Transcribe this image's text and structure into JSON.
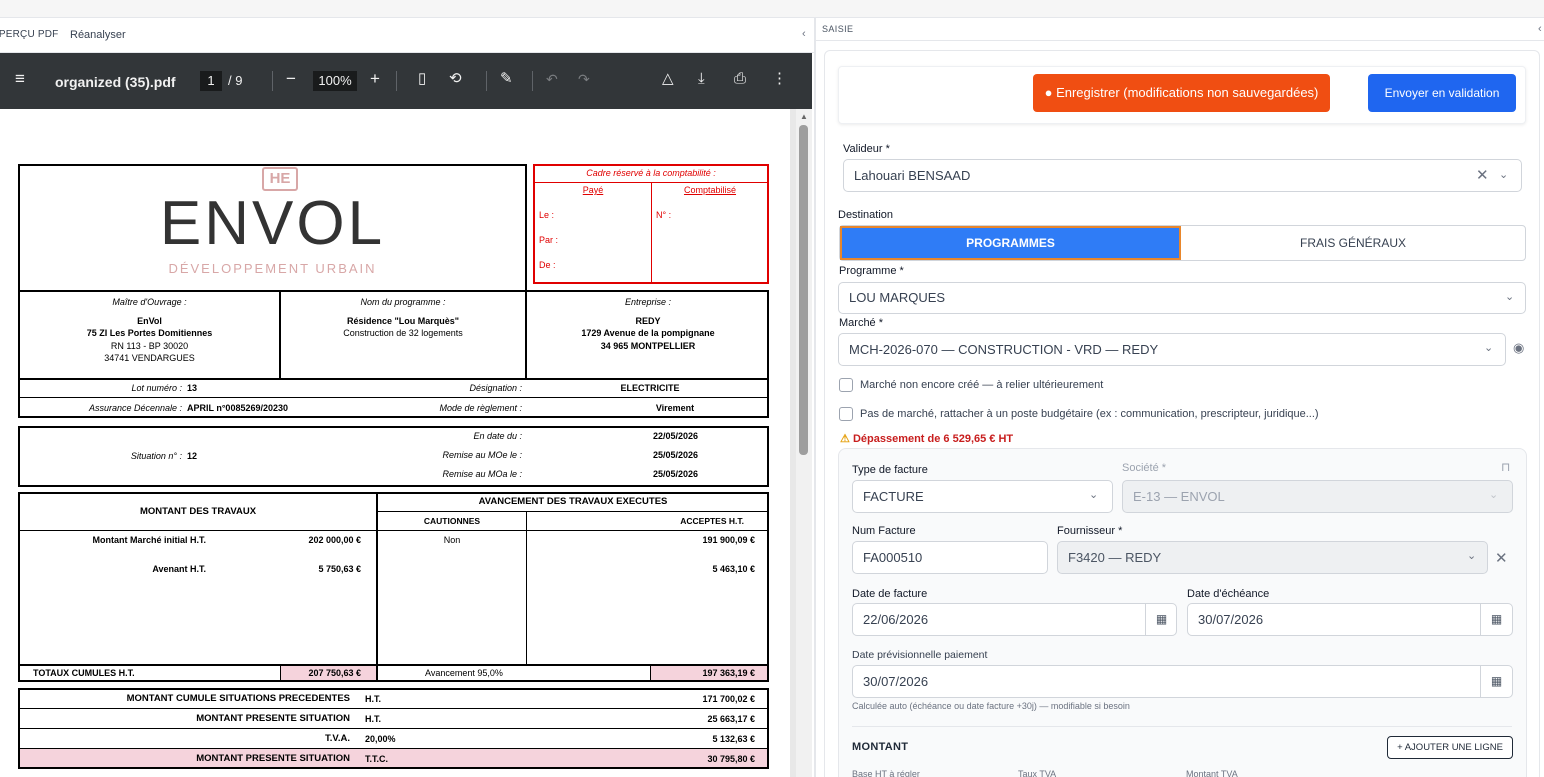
{
  "left": {
    "tab_preview": "APERÇU PDF",
    "tab_reanalyse": "Réanalyser",
    "collapse": "‹"
  },
  "pdf": {
    "filename": "organized (35).pdf",
    "page": "1",
    "of": "/  9",
    "zoom": "100%"
  },
  "doc": {
    "compta_title": "Cadre réservé à la comptabilité :",
    "paye": "Payé",
    "comptabilise": "Comptabilisé",
    "le": "Le :",
    "par": "Par :",
    "de": "De :",
    "no": "N° :",
    "logo_mark": "HE",
    "logo_word": "ENVOL",
    "logo_sub": "DÉVELOPPEMENT URBAIN",
    "moa_label": "Maître d'Ouvrage :",
    "moa_name": "EnVol",
    "moa_addr1": "75 ZI Les Portes Domitiennes",
    "moa_addr2": "RN 113 - BP 30020",
    "moa_addr3": "34741 VENDARGUES",
    "prog_label": "Nom du programme :",
    "prog_name": "Résidence \"Lou Marquès\"",
    "prog_desc": "Construction de 32 logements",
    "ent_label": "Entreprise :",
    "ent_name": "REDY",
    "ent_addr1": "1729 Avenue de la pompignane",
    "ent_addr2": "34 965 MONTPELLIER",
    "lot_label": "Lot numéro :",
    "lot_value": "13",
    "desig_label": "Désignation :",
    "desig_value": "ELECTRICITE",
    "assur_label": "Assurance Décennale :",
    "assur_value": "APRIL n°0085269/20230",
    "mode_label": "Mode de règlement :",
    "mode_value": "Virement",
    "sit_label": "Situation n° :",
    "sit_value": "12",
    "endate_label": "En date du :",
    "endate_value": "22/05/2026",
    "moe_label": "Remise au MOe le :",
    "moe_value": "25/05/2026",
    "moa2_label": "Remise au MOa le :",
    "moa2_value": "25/05/2026",
    "mt_header": "MONTANT DES TRAVAUX",
    "av_header": "AVANCEMENT DES TRAVAUX EXECUTES",
    "cautionnes": "CAUTIONNES",
    "acceptes": "ACCEPTES H.T.",
    "marche_init_label": "Montant Marché initial  H.T.",
    "marche_init_value": "202 000,00 €",
    "marche_caut": "Non",
    "marche_acc": "191 900,09 €",
    "avenant_label": "Avenant  H.T.",
    "avenant_value": "5 750,63 €",
    "avenant_acc": "5 463,10 €",
    "totaux_label": "TOTAUX CUMULES H.T.",
    "totaux_value": "207 750,63 €",
    "avancement": "Avancement 95,0%",
    "totaux_acc": "197 363,19 €",
    "cumul_label": "MONTANT CUMULE SITUATIONS PRECEDENTES",
    "cumul_unit": "H.T.",
    "cumul_value": "171 700,02 €",
    "pres_label": "MONTANT PRESENTE SITUATION",
    "pres_unit": "H.T.",
    "pres_value": "25 663,17 €",
    "tva_label": "T.V.A.",
    "tva_rate": "20,00%",
    "tva_value": "5 132,63 €",
    "ttc_label": "MONTANT PRESENTE SITUATION",
    "ttc_unit": "T.T.C.",
    "ttc_value": "30 795,80 €"
  },
  "right": {
    "section": "SAISIE",
    "collapse": "‹",
    "save_label": "Enregistrer (modifications non sauvegardées)",
    "send_label": "Envoyer en validation",
    "valideur_label": "Valideur *",
    "valideur_value": "Lahouari BENSAAD",
    "destination_label": "Destination",
    "dest_prog": "PROGRAMMES",
    "dest_frais": "FRAIS GÉNÉRAUX",
    "programme_label": "Programme *",
    "programme_value": "LOU MARQUES",
    "marche_label": "Marché *",
    "marche_value": "MCH-2026-070 — CONSTRUCTION - VRD — REDY",
    "chk1": "Marché non encore créé — à relier ultérieurement",
    "chk2": "Pas de marché, rattacher à un poste budgétaire (ex : communication, prescripteur, juridique...)",
    "warning": "Dépassement de 6 529,65 € HT",
    "type_label": "Type de facture",
    "type_value": "FACTURE",
    "societe_label": "Société *",
    "societe_value": "E-13 — ENVOL",
    "num_label": "Num Facture",
    "num_value": "FA000510",
    "fourn_label": "Fournisseur *",
    "fourn_value": "F3420 — REDY",
    "datefac_label": "Date de facture",
    "datefac_value": "22/06/2026",
    "dateech_label": "Date d'échéance",
    "dateech_value": "30/07/2026",
    "dateprev_label": "Date prévisionnelle paiement",
    "dateprev_value": "30/07/2026",
    "hint": "Calculée auto (échéance ou date facture +30j) — modifiable si besoin",
    "montant_label": "MONTANT",
    "add_line": "+ AJOUTER UNE LIGNE",
    "col_base": "Base HT à régler",
    "col_taux": "Taux TVA",
    "col_mt": "Montant TVA"
  },
  "colors": {
    "save_btn": "#f04e12",
    "send_btn": "#1f66f0",
    "active_segment": "#2f7cf6",
    "warning": "#c81e1e",
    "pdf_toolbar": "#323639",
    "compta_red": "#e00000",
    "total_highlight": "#f5d3dc"
  }
}
